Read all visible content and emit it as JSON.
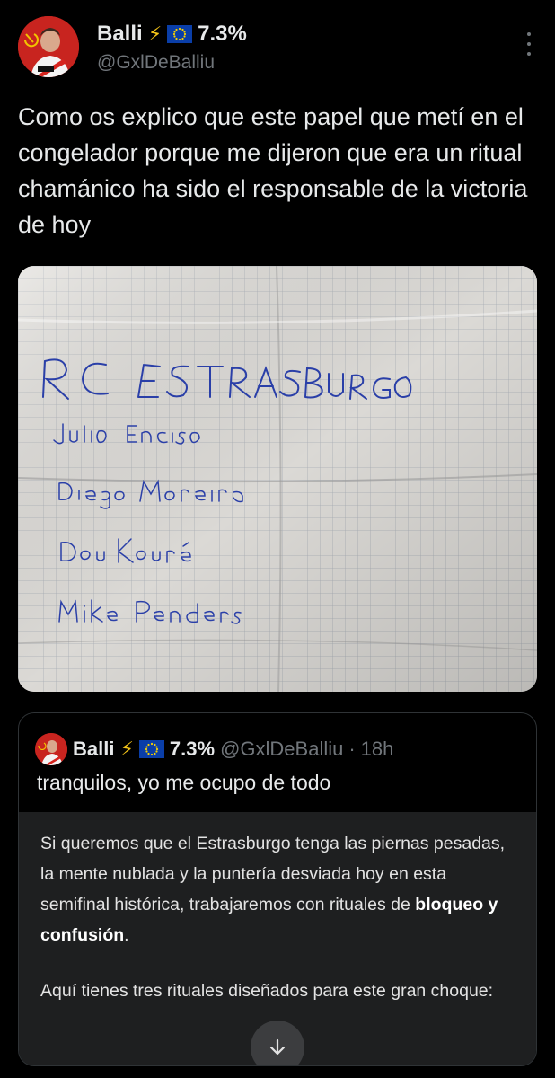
{
  "author": {
    "name": "Balli",
    "bolt": "⚡",
    "percent": "7.3%",
    "handle": "@GxlDeBalliu"
  },
  "tweet": {
    "text": "Como os explico que este papel que metí en el congelador porque me dijeron que era un ritual chamánico ha sido el responsable de la victoria de hoy"
  },
  "photo": {
    "handwritten_lines": [
      "RC ESTRASBURGO",
      "Julio Enciso",
      "Diego Moreira",
      "Dou Kouré",
      "Mike Penders"
    ]
  },
  "quote": {
    "name": "Balli",
    "bolt": "⚡",
    "percent": "7.3%",
    "handle": "@GxlDeBalliu",
    "separator": "·",
    "time": "18h",
    "text": "tranquilos, yo me ocupo de todo",
    "card": {
      "p1_text": "Si queremos que el Estrasburgo tenga las piernas pesadas, la mente nublada y la puntería desviada hoy en esta semifinal histórica, trabajaremos con rituales de ",
      "p1_bold": "bloqueo y confusión",
      "p1_end": ".",
      "p2": "Aquí tienes tres rituales diseñados para este gran choque:"
    }
  },
  "colors": {
    "background": "#000000",
    "text": "#e7e9ea",
    "muted": "#71767b",
    "card": "#1e1f20",
    "avatar": "#c8241f"
  }
}
